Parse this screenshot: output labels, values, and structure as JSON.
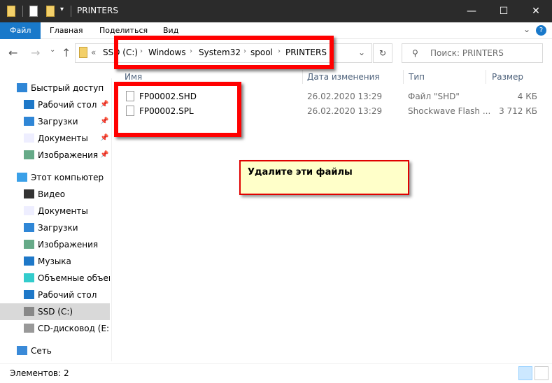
{
  "window": {
    "title": "PRINTERS",
    "minimize": "—",
    "maximize": "☐",
    "close": "✕"
  },
  "ribbon": {
    "tabs": [
      "Файл",
      "Главная",
      "Поделиться",
      "Вид"
    ],
    "collapse": "⌄",
    "help": "?"
  },
  "address": {
    "prefix": "«",
    "crumbs": [
      "SSD (C:)",
      "Windows",
      "System32",
      "spool",
      "PRINTERS"
    ],
    "dropdown": "⌄",
    "refresh": "↻"
  },
  "search": {
    "placeholder": "Поиск: PRINTERS"
  },
  "sidebar": {
    "items": [
      {
        "label": "Быстрый доступ",
        "icon": "star-icon",
        "level": 0,
        "pinned": false
      },
      {
        "label": "Рабочий стол",
        "icon": "desktop-icon",
        "level": 1,
        "pinned": true
      },
      {
        "label": "Загрузки",
        "icon": "downloads-icon",
        "level": 1,
        "pinned": true
      },
      {
        "label": "Документы",
        "icon": "documents-icon",
        "level": 1,
        "pinned": true
      },
      {
        "label": "Изображения",
        "icon": "pictures-icon",
        "level": 1,
        "pinned": true
      },
      {
        "label": "Этот компьютер",
        "icon": "computer-icon",
        "level": 0,
        "pinned": false
      },
      {
        "label": "Видео",
        "icon": "video-icon",
        "level": 1,
        "pinned": false
      },
      {
        "label": "Документы",
        "icon": "documents-icon",
        "level": 1,
        "pinned": false
      },
      {
        "label": "Загрузки",
        "icon": "downloads-icon",
        "level": 1,
        "pinned": false
      },
      {
        "label": "Изображения",
        "icon": "pictures-icon",
        "level": 1,
        "pinned": false
      },
      {
        "label": "Музыка",
        "icon": "music-icon",
        "level": 1,
        "pinned": false
      },
      {
        "label": "Объемные объекты",
        "icon": "3d-objects-icon",
        "level": 1,
        "pinned": false
      },
      {
        "label": "Рабочий стол",
        "icon": "desktop-icon",
        "level": 1,
        "pinned": false
      },
      {
        "label": "SSD (C:)",
        "icon": "drive-icon",
        "level": 1,
        "pinned": false,
        "selected": true
      },
      {
        "label": "CD-дисковод (E:)",
        "icon": "cd-drive-icon",
        "level": 1,
        "pinned": false
      },
      {
        "label": "Сеть",
        "icon": "network-icon",
        "level": 0,
        "pinned": false
      }
    ]
  },
  "columns": [
    "Имя",
    "Дата изменения",
    "Тип",
    "Размер"
  ],
  "files": [
    {
      "name": "FP00002.SHD",
      "date": "26.02.2020 13:29",
      "type": "Файл \"SHD\"",
      "size": "4 КБ"
    },
    {
      "name": "FP00002.SPL",
      "date": "26.02.2020 13:29",
      "type": "Shockwave Flash ...",
      "size": "3 712 КБ"
    }
  ],
  "annotation": {
    "text": "Удалите эти файлы"
  },
  "status": {
    "items": "Элементов: 2"
  },
  "colors": {
    "titlebar": "#2b2b2b",
    "file_tab": "#1979ca",
    "highlight": "#ff0000",
    "note_bg": "#ffffc9",
    "selected": "#d9d9d9"
  }
}
